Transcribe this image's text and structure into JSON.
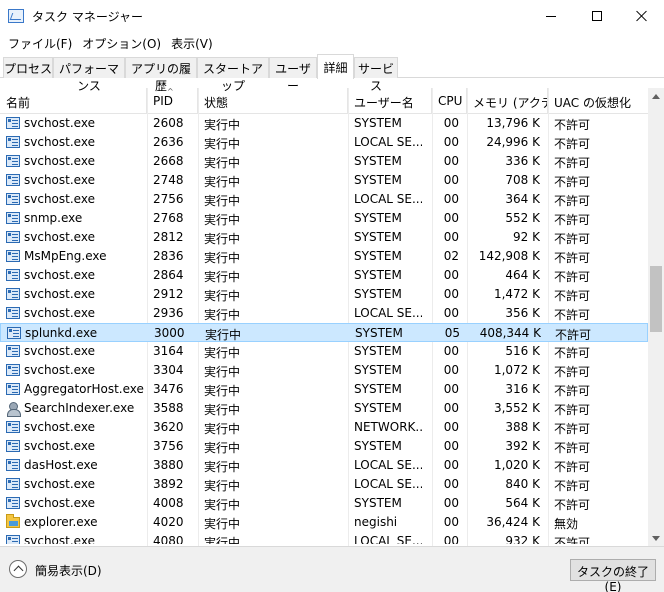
{
  "window": {
    "title": "タスク マネージャー"
  },
  "menu": [
    "ファイル(F)",
    "オプション(O)",
    "表示(V)"
  ],
  "tabs": [
    {
      "label": "プロセス",
      "active": false
    },
    {
      "label": "パフォーマンス",
      "active": false
    },
    {
      "label": "アプリの履歴",
      "active": false
    },
    {
      "label": "スタートアップ",
      "active": false
    },
    {
      "label": "ユーザー",
      "active": false
    },
    {
      "label": "詳細",
      "active": true
    },
    {
      "label": "サービス",
      "active": false
    }
  ],
  "columns": {
    "name": "名前",
    "pid": "PID",
    "status": "状態",
    "user": "ユーザー名",
    "cpu": "CPU",
    "memory": "メモリ (アクティ",
    "uac": "UAC の仮想化"
  },
  "rows": [
    {
      "icon": "service",
      "name": "svchost.exe",
      "pid": "2608",
      "status": "実行中",
      "user": "SYSTEM",
      "cpu": "00",
      "memory": "13,796 K",
      "uac": "不許可"
    },
    {
      "icon": "service",
      "name": "svchost.exe",
      "pid": "2636",
      "status": "実行中",
      "user": "LOCAL SE...",
      "cpu": "00",
      "memory": "24,996 K",
      "uac": "不許可"
    },
    {
      "icon": "service",
      "name": "svchost.exe",
      "pid": "2668",
      "status": "実行中",
      "user": "SYSTEM",
      "cpu": "00",
      "memory": "336 K",
      "uac": "不許可"
    },
    {
      "icon": "service",
      "name": "svchost.exe",
      "pid": "2748",
      "status": "実行中",
      "user": "SYSTEM",
      "cpu": "00",
      "memory": "708 K",
      "uac": "不許可"
    },
    {
      "icon": "service",
      "name": "svchost.exe",
      "pid": "2756",
      "status": "実行中",
      "user": "LOCAL SE...",
      "cpu": "00",
      "memory": "364 K",
      "uac": "不許可"
    },
    {
      "icon": "service",
      "name": "snmp.exe",
      "pid": "2768",
      "status": "実行中",
      "user": "SYSTEM",
      "cpu": "00",
      "memory": "552 K",
      "uac": "不許可"
    },
    {
      "icon": "service",
      "name": "svchost.exe",
      "pid": "2812",
      "status": "実行中",
      "user": "SYSTEM",
      "cpu": "00",
      "memory": "92 K",
      "uac": "不許可"
    },
    {
      "icon": "service",
      "name": "MsMpEng.exe",
      "pid": "2836",
      "status": "実行中",
      "user": "SYSTEM",
      "cpu": "02",
      "memory": "142,908 K",
      "uac": "不許可"
    },
    {
      "icon": "service",
      "name": "svchost.exe",
      "pid": "2864",
      "status": "実行中",
      "user": "SYSTEM",
      "cpu": "00",
      "memory": "464 K",
      "uac": "不許可"
    },
    {
      "icon": "service",
      "name": "svchost.exe",
      "pid": "2912",
      "status": "実行中",
      "user": "SYSTEM",
      "cpu": "00",
      "memory": "1,472 K",
      "uac": "不許可"
    },
    {
      "icon": "service",
      "name": "svchost.exe",
      "pid": "2936",
      "status": "実行中",
      "user": "LOCAL SE...",
      "cpu": "00",
      "memory": "356 K",
      "uac": "不許可"
    },
    {
      "icon": "service",
      "name": "splunkd.exe",
      "pid": "3000",
      "status": "実行中",
      "user": "SYSTEM",
      "cpu": "05",
      "memory": "408,344 K",
      "uac": "不許可",
      "selected": true
    },
    {
      "icon": "service",
      "name": "svchost.exe",
      "pid": "3164",
      "status": "実行中",
      "user": "SYSTEM",
      "cpu": "00",
      "memory": "516 K",
      "uac": "不許可"
    },
    {
      "icon": "service",
      "name": "svchost.exe",
      "pid": "3304",
      "status": "実行中",
      "user": "SYSTEM",
      "cpu": "00",
      "memory": "1,072 K",
      "uac": "不許可"
    },
    {
      "icon": "service",
      "name": "AggregatorHost.exe",
      "pid": "3476",
      "status": "実行中",
      "user": "SYSTEM",
      "cpu": "00",
      "memory": "316 K",
      "uac": "不許可"
    },
    {
      "icon": "person",
      "name": "SearchIndexer.exe",
      "pid": "3588",
      "status": "実行中",
      "user": "SYSTEM",
      "cpu": "00",
      "memory": "3,552 K",
      "uac": "不許可"
    },
    {
      "icon": "service",
      "name": "svchost.exe",
      "pid": "3620",
      "status": "実行中",
      "user": "NETWORK...",
      "cpu": "00",
      "memory": "388 K",
      "uac": "不許可"
    },
    {
      "icon": "service",
      "name": "svchost.exe",
      "pid": "3756",
      "status": "実行中",
      "user": "SYSTEM",
      "cpu": "00",
      "memory": "392 K",
      "uac": "不許可"
    },
    {
      "icon": "service",
      "name": "dasHost.exe",
      "pid": "3880",
      "status": "実行中",
      "user": "LOCAL SE...",
      "cpu": "00",
      "memory": "1,020 K",
      "uac": "不許可"
    },
    {
      "icon": "service",
      "name": "svchost.exe",
      "pid": "3892",
      "status": "実行中",
      "user": "LOCAL SE...",
      "cpu": "00",
      "memory": "840 K",
      "uac": "不許可"
    },
    {
      "icon": "service",
      "name": "svchost.exe",
      "pid": "4008",
      "status": "実行中",
      "user": "SYSTEM",
      "cpu": "00",
      "memory": "564 K",
      "uac": "不許可"
    },
    {
      "icon": "folder",
      "name": "explorer.exe",
      "pid": "4020",
      "status": "実行中",
      "user": "negishi",
      "cpu": "00",
      "memory": "36,424 K",
      "uac": "無効"
    },
    {
      "icon": "service",
      "name": "svchost.exe",
      "pid": "4080",
      "status": "実行中",
      "user": "LOCAL SE...",
      "cpu": "00",
      "memory": "932 K",
      "uac": "不許可"
    }
  ],
  "scroll_position": 0.45,
  "footer": {
    "fewer_details": "簡易表示(D)",
    "end_task": "タスクの終了(E)"
  },
  "colors": {
    "selected_bg": "#cce8ff",
    "selected_border": "#99d1ff",
    "service_icon": "#2b6ab3"
  }
}
